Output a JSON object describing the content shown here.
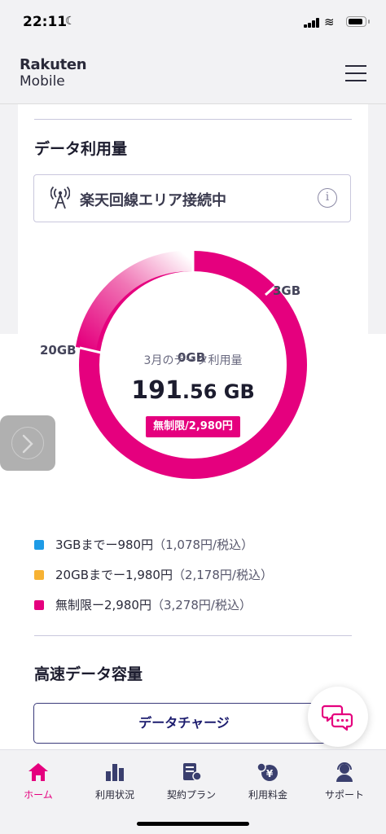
{
  "status_bar": {
    "time": "22:11",
    "moon_glyph": "☾",
    "wifi_glyph": "≋"
  },
  "header": {
    "logo_line1": "Rakuten",
    "logo_line2": "Mobile",
    "menu_icon": "hamburger-icon"
  },
  "data_usage": {
    "title": "データ利用量",
    "connection_status": "楽天回線エリア接続中",
    "info_glyph": "i",
    "donut": {
      "tick_labels": {
        "zero": "0GB",
        "three": "3GB",
        "twenty": "20GB"
      },
      "center_label": "3月のデータ利用量",
      "usage_integer": "191",
      "usage_decimal": ".56 GB",
      "plan_badge": "無制限/2,980円"
    },
    "legend": [
      {
        "color": "#1e9be6",
        "label": "3GBまでー980円",
        "sub": "（1,078円/税込）"
      },
      {
        "color": "#f7b233",
        "label": "20GBまでー1,980円",
        "sub": "（2,178円/税込）"
      },
      {
        "color": "#e5007e",
        "label": "無制限ー2,980円",
        "sub": "（3,278円/税込）"
      }
    ]
  },
  "high_speed": {
    "title": "高速データ容量",
    "charge_button": "データチャージ"
  },
  "tab_bar": [
    {
      "label": "ホーム",
      "icon": "home-icon",
      "active": true
    },
    {
      "label": "利用状況",
      "icon": "bar-chart-icon",
      "active": false
    },
    {
      "label": "契約プラン",
      "icon": "contract-icon",
      "active": false
    },
    {
      "label": "利用料金",
      "icon": "fee-icon",
      "active": false
    },
    {
      "label": "サポート",
      "icon": "support-icon",
      "active": false
    }
  ],
  "colors": {
    "accent": "#e5007e",
    "navy": "#1c1c6e",
    "border": "#c9c7dd"
  }
}
